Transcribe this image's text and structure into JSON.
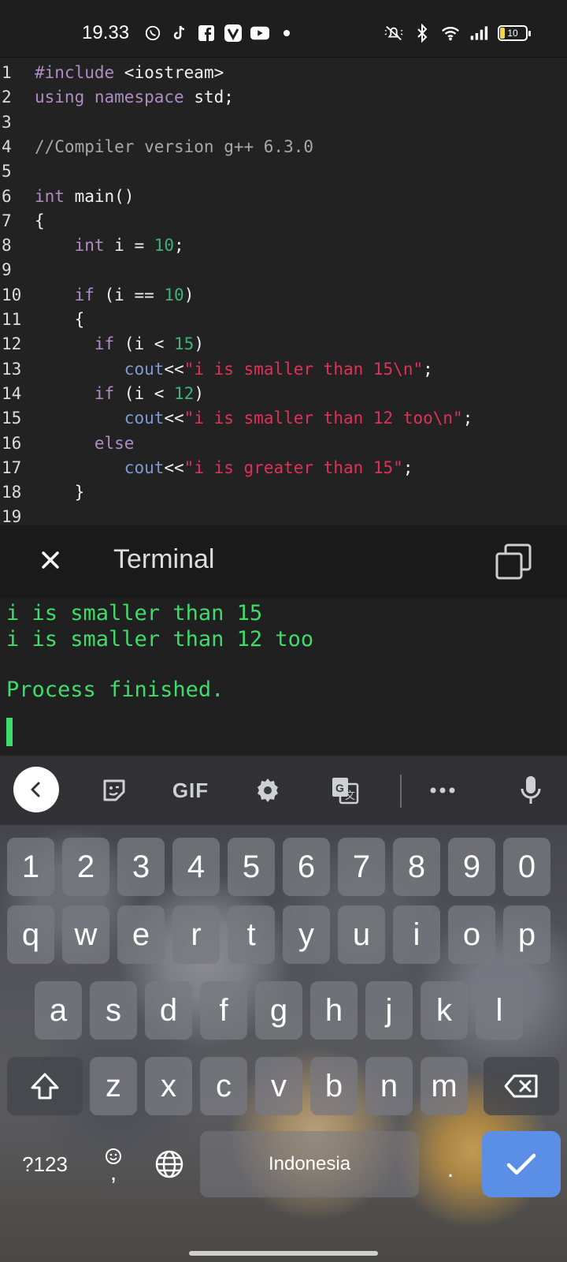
{
  "status_bar": {
    "time": "19.33",
    "left_icons": [
      "whatsapp-icon",
      "tiktok-icon",
      "facebook-icon",
      "vivid-icon",
      "youtube-icon",
      "dot-icon"
    ],
    "right_icons": [
      "mute-icon",
      "bluetooth-icon",
      "wifi-icon",
      "signal-icon"
    ],
    "battery": "10"
  },
  "editor": {
    "lines": [
      {
        "n": "1",
        "html": "<span class='pp'>#include</span> &lt;iostream&gt;"
      },
      {
        "n": "2",
        "html": "<span class='kw'>using</span> <span class='kw'>namespace</span> std;"
      },
      {
        "n": "3",
        "html": ""
      },
      {
        "n": "4",
        "html": "<span class='cm'>//Compiler version g++ 6.3.0</span>"
      },
      {
        "n": "5",
        "html": ""
      },
      {
        "n": "6",
        "html": "<span class='kw'>int</span> main()"
      },
      {
        "n": "7",
        "html": "{"
      },
      {
        "n": "8",
        "html": "    <span class='kw'>int</span> i = <span class='num'>10</span>;"
      },
      {
        "n": "9",
        "html": ""
      },
      {
        "n": "10",
        "html": "    <span class='kw'>if</span> (i == <span class='num'>10</span>)"
      },
      {
        "n": "11",
        "html": "    {"
      },
      {
        "n": "12",
        "html": "      <span class='kw'>if</span> (i &lt; <span class='num'>15</span>)"
      },
      {
        "n": "13",
        "html": "         <span class='fn'>cout</span>&lt;&lt;<span class='str'>\"i is smaller than 15\\n\"</span>;"
      },
      {
        "n": "14",
        "html": "      <span class='kw'>if</span> (i &lt; <span class='num'>12</span>)"
      },
      {
        "n": "15",
        "html": "         <span class='fn'>cout</span>&lt;&lt;<span class='str'>\"i is smaller than 12 too\\n\"</span>;"
      },
      {
        "n": "16",
        "html": "      <span class='kw'>else</span>"
      },
      {
        "n": "17",
        "html": "         <span class='fn'>cout</span>&lt;&lt;<span class='str'>\"i is greater than 15\"</span>;"
      },
      {
        "n": "18",
        "html": "    }"
      },
      {
        "n": "19",
        "html": ""
      }
    ]
  },
  "terminal": {
    "title": "Terminal",
    "output": [
      "i is smaller than 15",
      "i is smaller than 12 too",
      "",
      "Process finished."
    ]
  },
  "keyboard": {
    "toolbar": [
      "back-icon",
      "sticker-icon",
      "GIF",
      "settings-icon",
      "translate-icon",
      "more-icon",
      "mic-icon"
    ],
    "row_numbers": [
      "1",
      "2",
      "3",
      "4",
      "5",
      "6",
      "7",
      "8",
      "9",
      "0"
    ],
    "row1": [
      "q",
      "w",
      "e",
      "r",
      "t",
      "y",
      "u",
      "i",
      "o",
      "p"
    ],
    "row2": [
      "a",
      "s",
      "d",
      "f",
      "g",
      "h",
      "j",
      "k",
      "l"
    ],
    "row3": [
      "z",
      "x",
      "c",
      "v",
      "b",
      "n",
      "m"
    ],
    "symbols_label": "?123",
    "comma": ",",
    "space_label": "Indonesia",
    "period": "."
  }
}
